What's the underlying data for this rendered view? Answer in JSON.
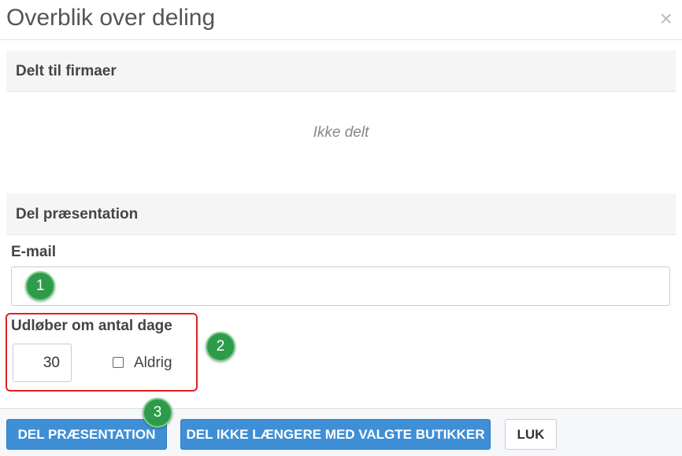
{
  "dialog": {
    "title": "Overblik over deling",
    "close_symbol": "×"
  },
  "shared_section": {
    "heading": "Delt til firmaer",
    "empty_text": "Ikke delt"
  },
  "share_section": {
    "heading": "Del præsentation",
    "email_label": "E-mail",
    "email_value": "",
    "expiry_label": "Udløber om antal dage",
    "expiry_days": "30",
    "never_label": "Aldrig",
    "never_checked": false
  },
  "badges": [
    "1",
    "2",
    "3"
  ],
  "buttons": {
    "share": "DEL PRÆSENTATION",
    "unshare": "DEL IKKE LÆNGERE MED VALGTE BUTIKKER",
    "close": "LUK"
  },
  "colors": {
    "primary": "#3f8fd6",
    "highlight": "#e02020",
    "badge": "#2e9b4a"
  }
}
